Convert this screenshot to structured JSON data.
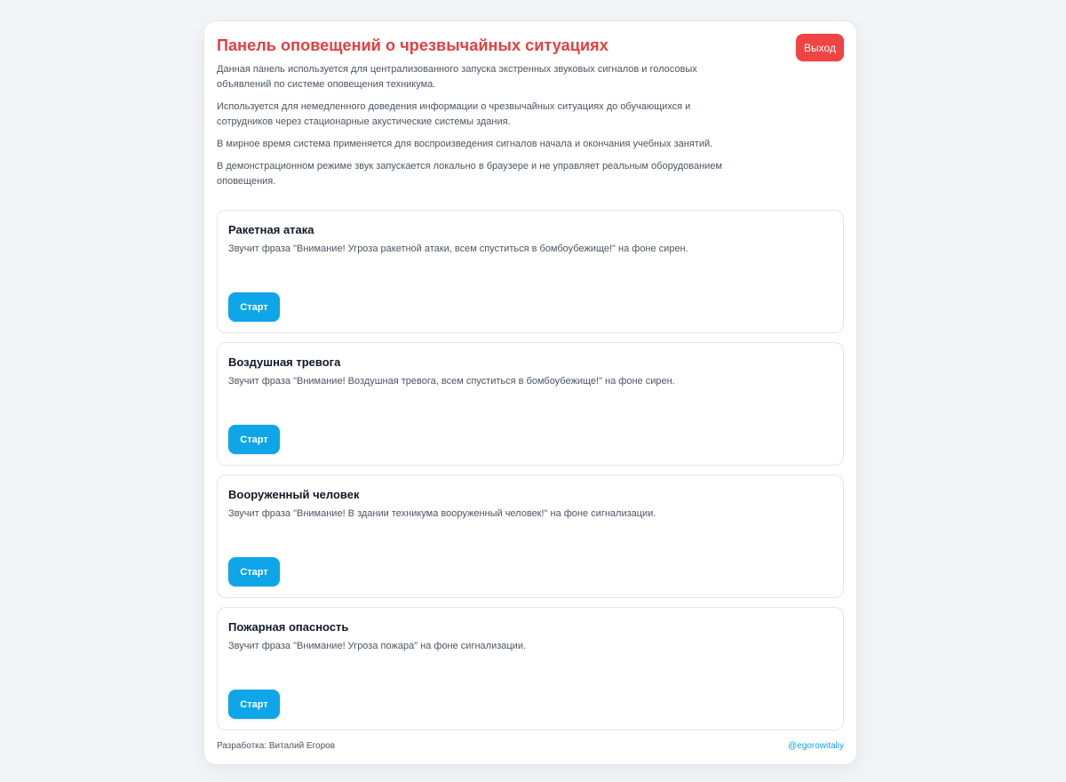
{
  "header": {
    "title": "Панель оповещений о чрезвычайных ситуациях",
    "logout_label": "Выход"
  },
  "intro": [
    "Данная панель используется для централизованного запуска экстренных звуковых сигналов и голосовых объявлений по системе оповещения техникума.",
    "Используется для немедленного доведения информации о чрезвычайных ситуациях до обучающихся и сотрудников через стационарные акустические системы здания.",
    "В мирное время система применяется для воспроизведения сигналов начала и окончания учебных занятий.",
    "В демонстрационном режиме звук запускается локально в браузере и не управляет реальным оборудованием оповещения."
  ],
  "alerts": [
    {
      "title": "Ракетная атака",
      "description": "Звучит фраза \"Внимание! Угроза ракетной атаки, всем спуститься в бомбоубежище!\" на фоне сирен.",
      "button_label": "Старт"
    },
    {
      "title": "Воздушная тревога",
      "description": "Звучит фраза \"Внимание! Воздушная тревога, всем спуститься в бомбоубежище!\" на фоне сирен.",
      "button_label": "Старт"
    },
    {
      "title": "Вооруженный человек",
      "description": "Звучит фраза \"Внимание! В здании техникума вооруженный человек!\" на фоне сигнализации.",
      "button_label": "Старт"
    },
    {
      "title": "Пожарная опасность",
      "description": "Звучит фраза \"Внимание! Угроза пожара\" на фоне сигнализации.",
      "button_label": "Старт"
    }
  ],
  "footer": {
    "developer": "Разработка: Виталий Егоров",
    "handle": "@egorowitaliy"
  },
  "colors": {
    "title": "#e53e3e",
    "logout_button": "#ef4444",
    "start_button": "#0ea5e9",
    "link": "#0ea5e9"
  }
}
